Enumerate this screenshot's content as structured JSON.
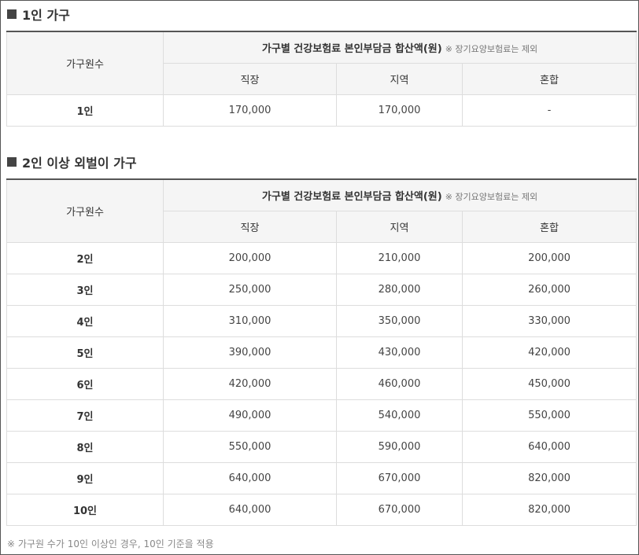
{
  "section1": {
    "title": "1인 가구",
    "header": {
      "group_label": "가구원수",
      "main_label": "가구별 건강보험료 본인부담금 합산액(원)",
      "note": "※ 장기요양보험료는 제외",
      "columns": [
        "직장",
        "지역",
        "혼합"
      ]
    },
    "rows": [
      {
        "label": "1인",
        "values": [
          "170,000",
          "170,000",
          "-"
        ]
      }
    ]
  },
  "section2": {
    "title": "2인 이상 외벌이 가구",
    "header": {
      "group_label": "가구원수",
      "main_label": "가구별 건강보험료 본인부담금 합산액(원)",
      "note": "※ 장기요양보험료는 제외",
      "columns": [
        "직장",
        "지역",
        "혼합"
      ]
    },
    "rows": [
      {
        "label": "2인",
        "values": [
          "200,000",
          "210,000",
          "200,000"
        ]
      },
      {
        "label": "3인",
        "values": [
          "250,000",
          "280,000",
          "260,000"
        ]
      },
      {
        "label": "4인",
        "values": [
          "310,000",
          "350,000",
          "330,000"
        ]
      },
      {
        "label": "5인",
        "values": [
          "390,000",
          "430,000",
          "420,000"
        ]
      },
      {
        "label": "6인",
        "values": [
          "420,000",
          "460,000",
          "450,000"
        ]
      },
      {
        "label": "7인",
        "values": [
          "490,000",
          "540,000",
          "550,000"
        ]
      },
      {
        "label": "8인",
        "values": [
          "550,000",
          "590,000",
          "640,000"
        ]
      },
      {
        "label": "9인",
        "values": [
          "640,000",
          "670,000",
          "820,000"
        ]
      },
      {
        "label": "10인",
        "values": [
          "640,000",
          "670,000",
          "820,000"
        ]
      }
    ]
  },
  "footnote": "※ 가구원 수가 10인 이상인 경우, 10인 기준을 적용"
}
